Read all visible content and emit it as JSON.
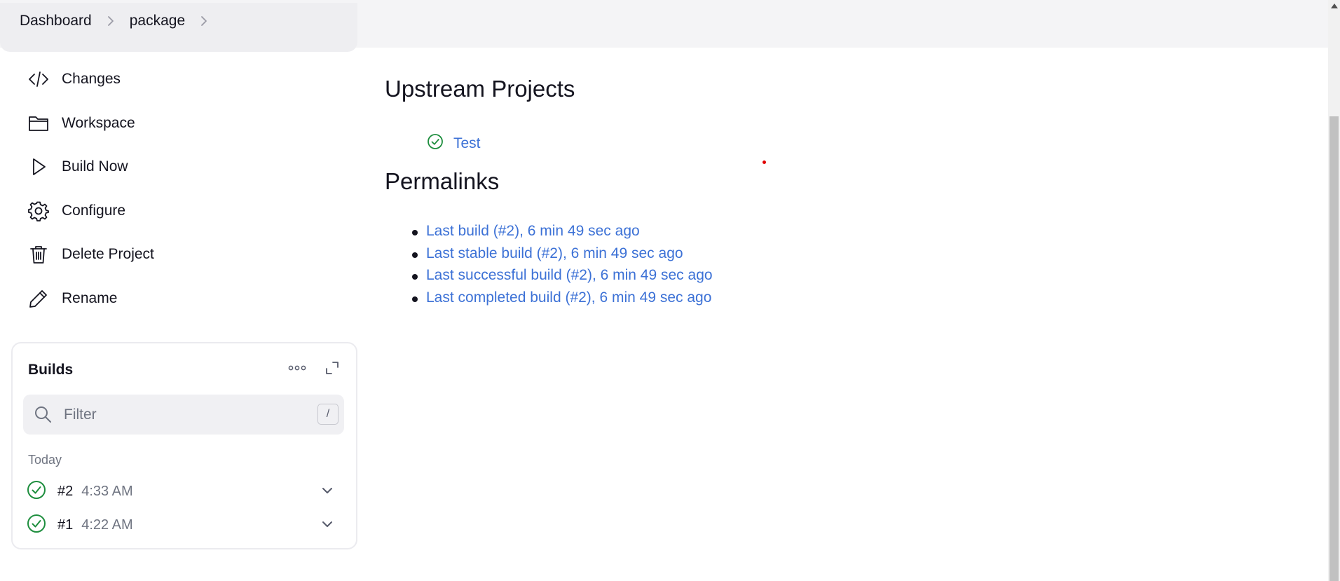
{
  "breadcrumb": {
    "items": [
      "Dashboard",
      "package"
    ]
  },
  "sidebar": {
    "menu": [
      {
        "label": "Changes",
        "icon": "code-icon"
      },
      {
        "label": "Workspace",
        "icon": "folder-icon"
      },
      {
        "label": "Build Now",
        "icon": "play-icon"
      },
      {
        "label": "Configure",
        "icon": "gear-icon"
      },
      {
        "label": "Delete Project",
        "icon": "trash-icon"
      },
      {
        "label": "Rename",
        "icon": "pencil-icon"
      }
    ]
  },
  "builds": {
    "title": "Builds",
    "filter_placeholder": "Filter",
    "shortcut_key": "/",
    "group_label": "Today",
    "rows": [
      {
        "number": "#2",
        "time": "4:33 AM",
        "status": "success"
      },
      {
        "number": "#1",
        "time": "4:22 AM",
        "status": "success"
      }
    ]
  },
  "main": {
    "upstream_title": "Upstream Projects",
    "upstream_projects": [
      {
        "name": "Test",
        "status": "success"
      }
    ],
    "permalinks_title": "Permalinks",
    "permalinks": [
      "Last build (#2), 6 min 49 sec ago",
      "Last stable build (#2), 6 min 49 sec ago",
      "Last successful build (#2), 6 min 49 sec ago",
      "Last completed build (#2), 6 min 49 sec ago"
    ]
  },
  "colors": {
    "link": "#3c71d6",
    "success": "#1e8e3e",
    "text": "#14141f",
    "muted": "#6f7481"
  }
}
